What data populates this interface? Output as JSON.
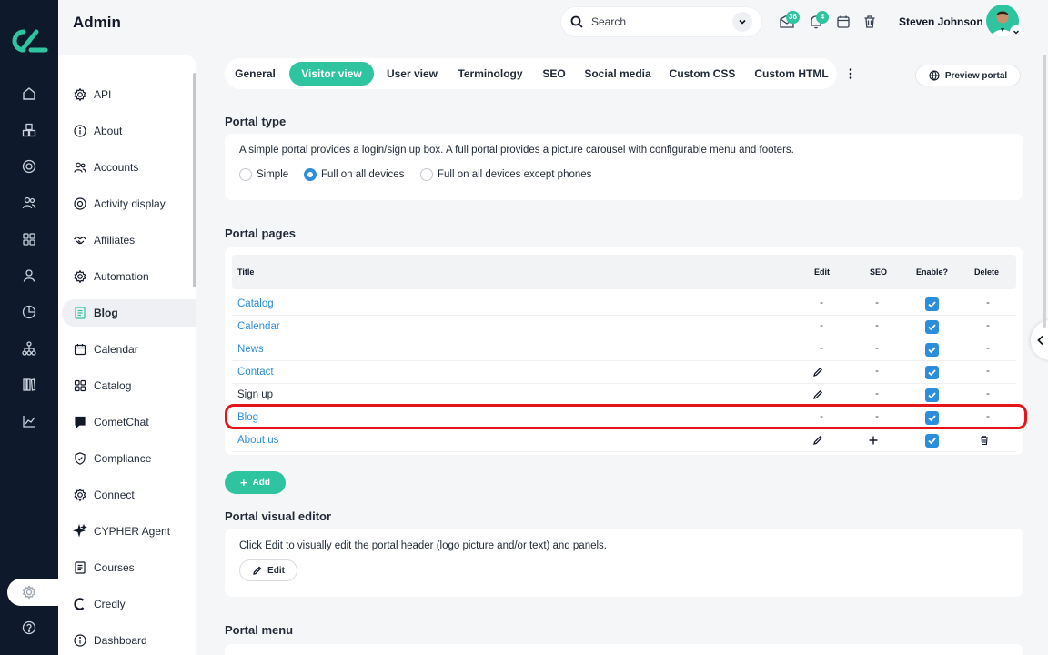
{
  "app": {
    "title": "Admin"
  },
  "header": {
    "search_placeholder": "Search",
    "messages_count": "36",
    "notifications_count": "4",
    "user_name": "Steven Johnson"
  },
  "rail": {
    "icons": [
      "home-icon",
      "cubes-icon",
      "target-icon",
      "users-icon",
      "grid-icon",
      "person-icon",
      "pie-chart-icon",
      "hierarchy-icon",
      "library-icon",
      "line-chart-icon",
      "settings-icon",
      "help-icon"
    ]
  },
  "sidebar": {
    "items": [
      {
        "label": "API",
        "icon": "gear-icon"
      },
      {
        "label": "About",
        "icon": "info-icon"
      },
      {
        "label": "Accounts",
        "icon": "users-icon"
      },
      {
        "label": "Activity display",
        "icon": "target-icon"
      },
      {
        "label": "Affiliates",
        "icon": "handshake-icon"
      },
      {
        "label": "Automation",
        "icon": "gear-icon"
      },
      {
        "label": "Blog",
        "icon": "document-icon",
        "active": true
      },
      {
        "label": "Calendar",
        "icon": "calendar-icon"
      },
      {
        "label": "Catalog",
        "icon": "grid-icon"
      },
      {
        "label": "CometChat",
        "icon": "chat-icon"
      },
      {
        "label": "Compliance",
        "icon": "shield-icon"
      },
      {
        "label": "Connect",
        "icon": "gear-icon"
      },
      {
        "label": "CYPHER Agent",
        "icon": "sparkle-icon"
      },
      {
        "label": "Courses",
        "icon": "document-icon"
      },
      {
        "label": "Credly",
        "icon": "credly-icon"
      },
      {
        "label": "Dashboard",
        "icon": "info-icon"
      }
    ]
  },
  "tabs": [
    "General",
    "Visitor view",
    "User view",
    "Terminology",
    "SEO",
    "Social media",
    "Custom CSS",
    "Custom HTML"
  ],
  "active_tab": "Visitor view",
  "preview_label": "Preview portal",
  "portal_type": {
    "title": "Portal type",
    "description": "A simple portal provides a login/sign up box. A full portal provides a picture carousel with configurable menu and footers.",
    "options": [
      "Simple",
      "Full on all devices",
      "Full on all devices except phones"
    ],
    "selected": "Full on all devices"
  },
  "portal_pages": {
    "title": "Portal pages",
    "columns": [
      "Title",
      "Edit",
      "SEO",
      "Enable?",
      "Delete"
    ],
    "rows": [
      {
        "title": "Catalog",
        "link": true,
        "edit": "-",
        "seo": "-",
        "enabled": true,
        "delete": "-"
      },
      {
        "title": "Calendar",
        "link": true,
        "edit": "-",
        "seo": "-",
        "enabled": true,
        "delete": "-"
      },
      {
        "title": "News",
        "link": true,
        "edit": "-",
        "seo": "-",
        "enabled": true,
        "delete": "-"
      },
      {
        "title": "Contact",
        "link": true,
        "edit": "pencil",
        "seo": "-",
        "enabled": true,
        "delete": "-"
      },
      {
        "title": "Sign up",
        "link": false,
        "edit": "pencil",
        "seo": "-",
        "enabled": true,
        "delete": "-"
      },
      {
        "title": "Blog",
        "link": true,
        "edit": "-",
        "seo": "-",
        "enabled": true,
        "delete": "-",
        "highlighted": true
      },
      {
        "title": "About us",
        "link": true,
        "edit": "pencil",
        "seo": "plus",
        "enabled": true,
        "delete": "trash"
      }
    ],
    "add_label": "Add"
  },
  "visual_editor": {
    "title": "Portal visual editor",
    "description": "Click Edit to visually edit the portal header (logo picture and/or text) and panels.",
    "edit_label": "Edit"
  },
  "portal_menu": {
    "title": "Portal menu"
  },
  "colors": {
    "accent": "#2ec4a0",
    "link": "#2c8ddb",
    "rail": "#0e1a2b",
    "highlight": "#e5141b"
  }
}
